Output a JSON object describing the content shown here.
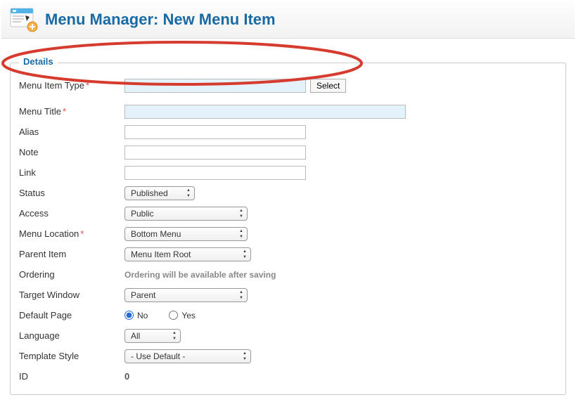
{
  "header": {
    "title": "Menu Manager: New Menu Item"
  },
  "fieldset": {
    "legend": "Details"
  },
  "fields": {
    "type": {
      "label": "Menu Item Type",
      "required": true,
      "value": "",
      "select_btn": "Select"
    },
    "title": {
      "label": "Menu Title",
      "required": true,
      "value": ""
    },
    "alias": {
      "label": "Alias",
      "value": ""
    },
    "note": {
      "label": "Note",
      "value": ""
    },
    "link": {
      "label": "Link",
      "value": ""
    },
    "status": {
      "label": "Status",
      "value": "Published"
    },
    "access": {
      "label": "Access",
      "value": "Public"
    },
    "location": {
      "label": "Menu Location",
      "required": true,
      "value": "Bottom Menu"
    },
    "parent": {
      "label": "Parent Item",
      "value": "Menu Item Root"
    },
    "ordering": {
      "label": "Ordering",
      "note": "Ordering will be available after saving"
    },
    "target": {
      "label": "Target Window",
      "value": "Parent"
    },
    "default": {
      "label": "Default Page",
      "no": "No",
      "yes": "Yes",
      "value": "No"
    },
    "language": {
      "label": "Language",
      "value": "All"
    },
    "template": {
      "label": "Template Style",
      "value": "- Use Default -"
    },
    "id": {
      "label": "ID",
      "value": "0"
    }
  }
}
